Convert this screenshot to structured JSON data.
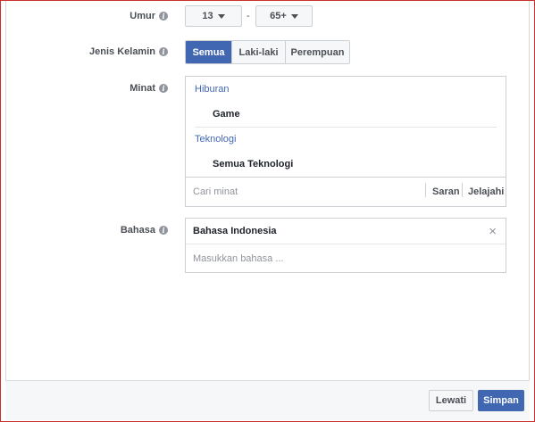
{
  "form": {
    "age": {
      "label": "Umur",
      "min": "13",
      "separator": "-",
      "max": "65+"
    },
    "gender": {
      "label": "Jenis Kelamin",
      "options": [
        "Semua",
        "Laki-laki",
        "Perempuan"
      ],
      "selected": "Semua"
    },
    "interests": {
      "label": "Minat",
      "groups": [
        {
          "category": "Hiburan",
          "items": [
            "Game"
          ]
        },
        {
          "category": "Teknologi",
          "items": [
            "Semua Teknologi"
          ]
        }
      ],
      "search_placeholder": "Cari minat",
      "suggest_label": "Saran",
      "browse_label": "Jelajahi"
    },
    "language": {
      "label": "Bahasa",
      "selected": "Bahasa Indonesia",
      "remove_glyph": "×",
      "input_placeholder": "Masukkan bahasa ..."
    }
  },
  "footer": {
    "skip_label": "Lewati",
    "save_label": "Simpan"
  },
  "icons": {
    "info": "i"
  },
  "colors": {
    "accent": "#4267b2",
    "frame_border": "#c9302c"
  }
}
